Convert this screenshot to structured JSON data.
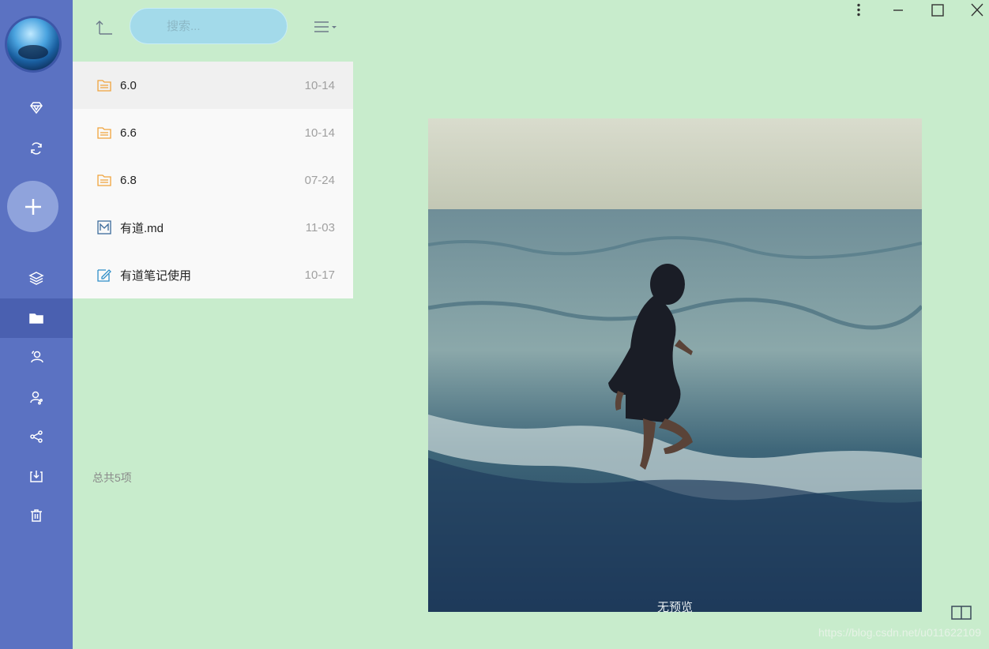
{
  "sidebar": {
    "items": [
      {
        "name": "diamond-icon"
      },
      {
        "name": "sync-icon"
      },
      {
        "name": "layers-icon"
      },
      {
        "name": "folder-icon",
        "active": true
      },
      {
        "name": "contacts-icon"
      },
      {
        "name": "user-share-icon"
      },
      {
        "name": "share-icon"
      },
      {
        "name": "download-box-icon"
      },
      {
        "name": "trash-icon"
      }
    ]
  },
  "toolbar": {
    "search_placeholder": "搜索..."
  },
  "files": [
    {
      "name": "6.0",
      "date": "10-14",
      "type": "folder"
    },
    {
      "name": "6.6",
      "date": "10-14",
      "type": "folder"
    },
    {
      "name": "6.8",
      "date": "07-24",
      "type": "folder"
    },
    {
      "name": "有道.md",
      "date": "11-03",
      "type": "markdown"
    },
    {
      "name": "有道笔记使用",
      "date": "10-17",
      "type": "note"
    }
  ],
  "total_label": "总共5项",
  "preview": {
    "caption": "无预览"
  },
  "watermark": "https://blog.csdn.net/u011622109",
  "colors": {
    "background": "#c8eccc",
    "sidebar": "#5b72c2",
    "search_bg": "#a3daea",
    "folder_icon": "#f0a33c"
  }
}
